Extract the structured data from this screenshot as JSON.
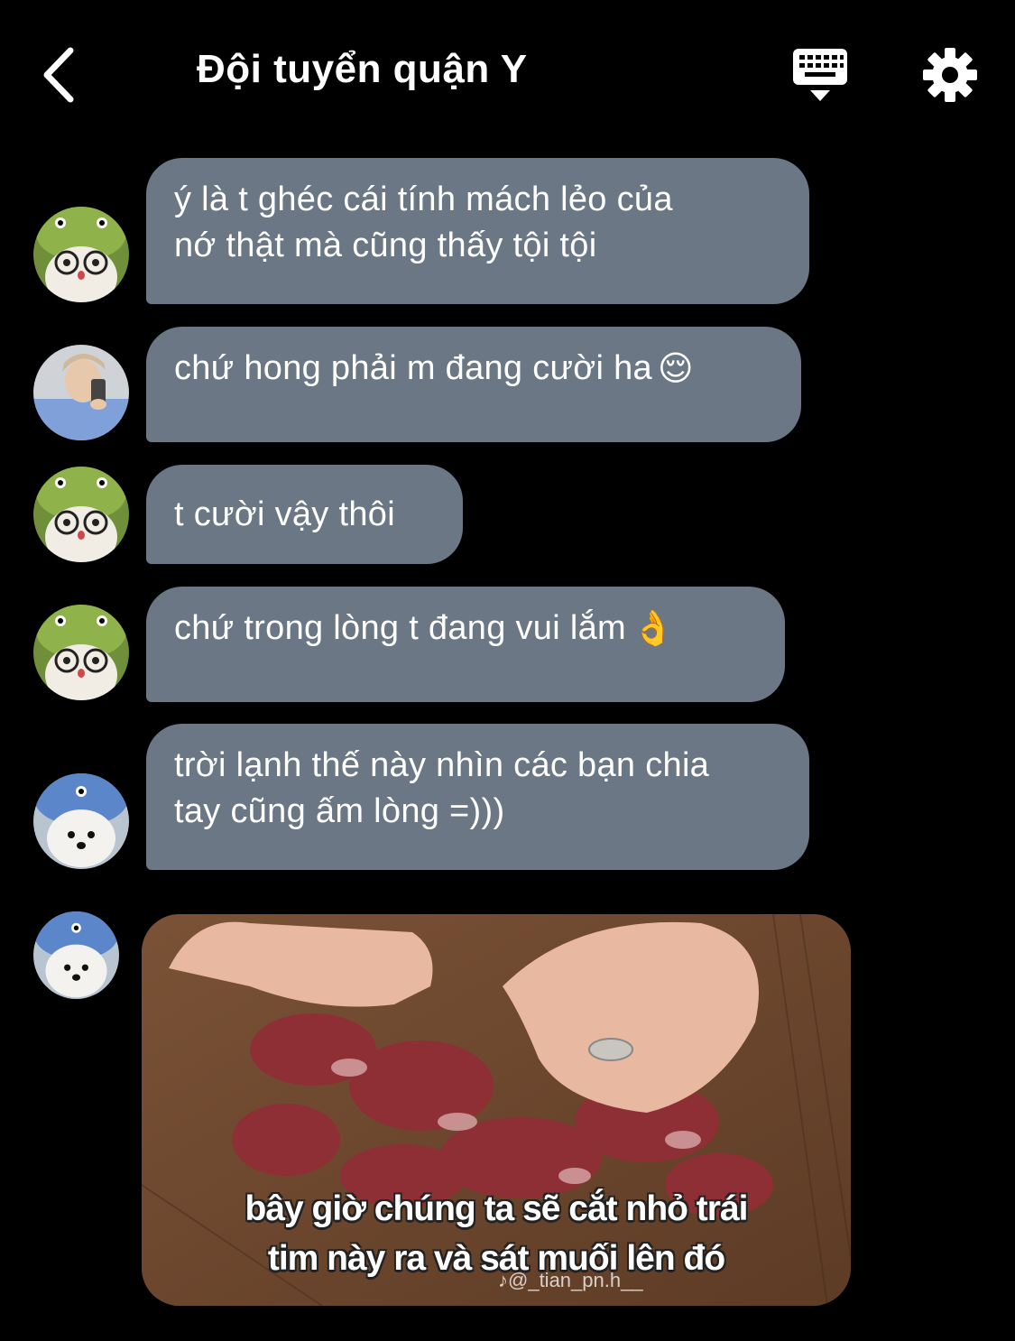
{
  "header": {
    "title": "Đội tuyển quận Y",
    "back_icon": "chevron-left-icon",
    "keyboard_icon": "keyboard-icon",
    "settings_icon": "gear-icon"
  },
  "messages": [
    {
      "avatar": "green-hat-avatar",
      "lines": [
        "ý là t ghéc cái tính mách lẻo của",
        "nớ thật mà cũng thấy tội tội"
      ]
    },
    {
      "avatar": "photo-avatar",
      "lines": [
        "chứ hong phải m đang cười ha"
      ],
      "emoji": "😌"
    },
    {
      "avatar": "green-hat-avatar",
      "lines": [
        "t cười vậy thôi"
      ]
    },
    {
      "avatar": "green-hat-avatar",
      "lines": [
        "chứ trong lòng t đang vui lắm"
      ],
      "emoji": "👌"
    },
    {
      "avatar": "blue-hat-dog-avatar",
      "lines": [
        "trời lạnh thế này nhìn các bạn chia",
        "tay cũng ấm lòng =)))"
      ]
    }
  ],
  "image_message": {
    "avatar": "blue-hat-dog-avatar",
    "caption_line1": "bây giờ chúng ta sẽ cắt nhỏ trái",
    "caption_line2": "tim này ra và sát muối lên đó",
    "watermark": "♪@_tian_pn.h__"
  },
  "colors": {
    "background": "#000000",
    "bubble": "#6b7785",
    "text": "#ffffff"
  }
}
